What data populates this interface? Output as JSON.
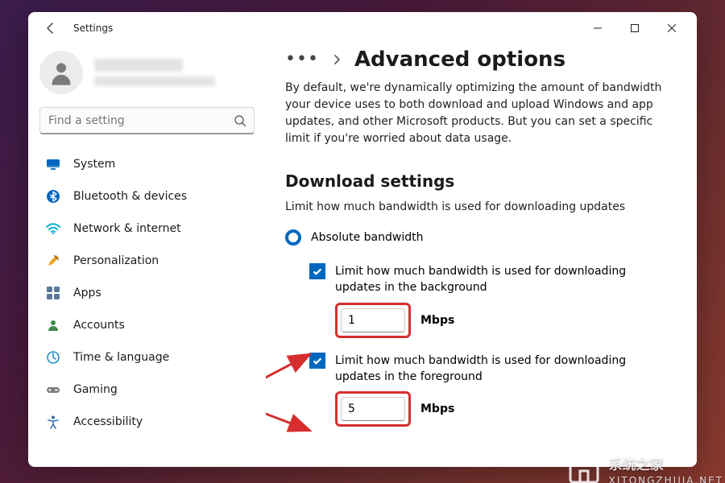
{
  "titlebar": {
    "app_title": "Settings"
  },
  "search": {
    "placeholder": "Find a setting"
  },
  "sidebar": {
    "items": [
      {
        "label": "System"
      },
      {
        "label": "Bluetooth & devices"
      },
      {
        "label": "Network & internet"
      },
      {
        "label": "Personalization"
      },
      {
        "label": "Apps"
      },
      {
        "label": "Accounts"
      },
      {
        "label": "Time & language"
      },
      {
        "label": "Gaming"
      },
      {
        "label": "Accessibility"
      }
    ]
  },
  "breadcrumb": {
    "title": "Advanced options"
  },
  "main": {
    "description": "By default, we're dynamically optimizing the amount of bandwidth your device uses to both download and upload Windows and app updates, and other Microsoft products. But you can set a specific limit if you're worried about data usage.",
    "download": {
      "heading": "Download settings",
      "subdesc": "Limit how much bandwidth is used for downloading updates",
      "radio_label": "Absolute bandwidth",
      "bg": {
        "label": "Limit how much bandwidth is used for downloading updates in the background",
        "value": "1",
        "unit": "Mbps"
      },
      "fg": {
        "label": "Limit how much bandwidth is used for downloading updates in the foreground",
        "value": "5",
        "unit": "Mbps"
      }
    }
  },
  "watermark": {
    "brand": "系统之家",
    "url": "XITONGZHIJIA.NET"
  }
}
